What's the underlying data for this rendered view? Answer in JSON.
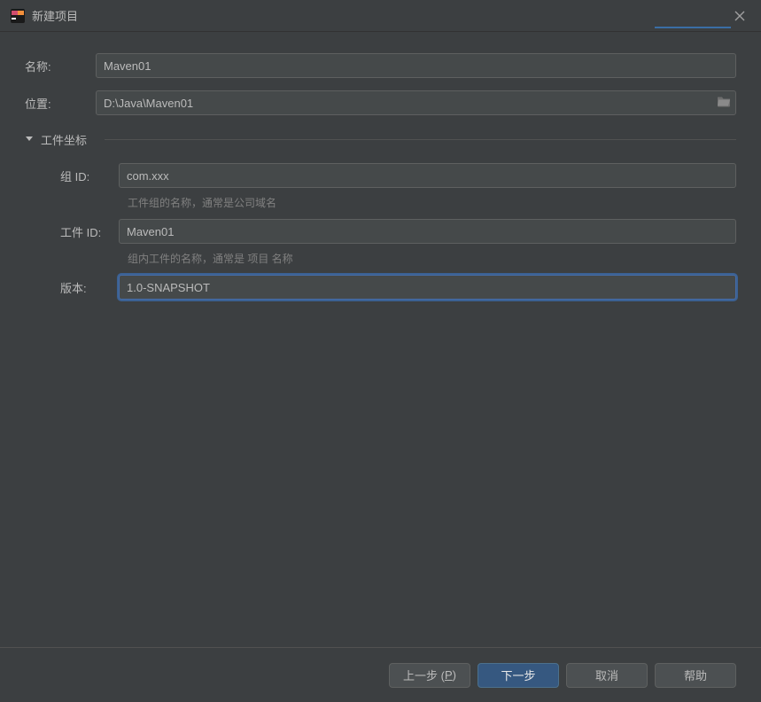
{
  "title": "新建项目",
  "fields": {
    "name_label": "名称:",
    "name_value": "Maven01",
    "location_label": "位置:",
    "location_value": "D:\\Java\\Maven01"
  },
  "section": {
    "coordinates_label": "工件坐标"
  },
  "artifact": {
    "group_label": "组 ID:",
    "group_value": "com.xxx",
    "group_hint": "工件组的名称，通常是公司域名",
    "artifact_label": "工件 ID:",
    "artifact_value": "Maven01",
    "artifact_hint": "组内工件的名称，通常是 项目 名称",
    "version_label": "版本:",
    "version_value": "1.0-SNAPSHOT"
  },
  "buttons": {
    "prev_prefix": "上一步 (",
    "prev_mnemonic": "P",
    "prev_suffix": ")",
    "next": "下一步",
    "cancel": "取消",
    "help": "帮助"
  }
}
